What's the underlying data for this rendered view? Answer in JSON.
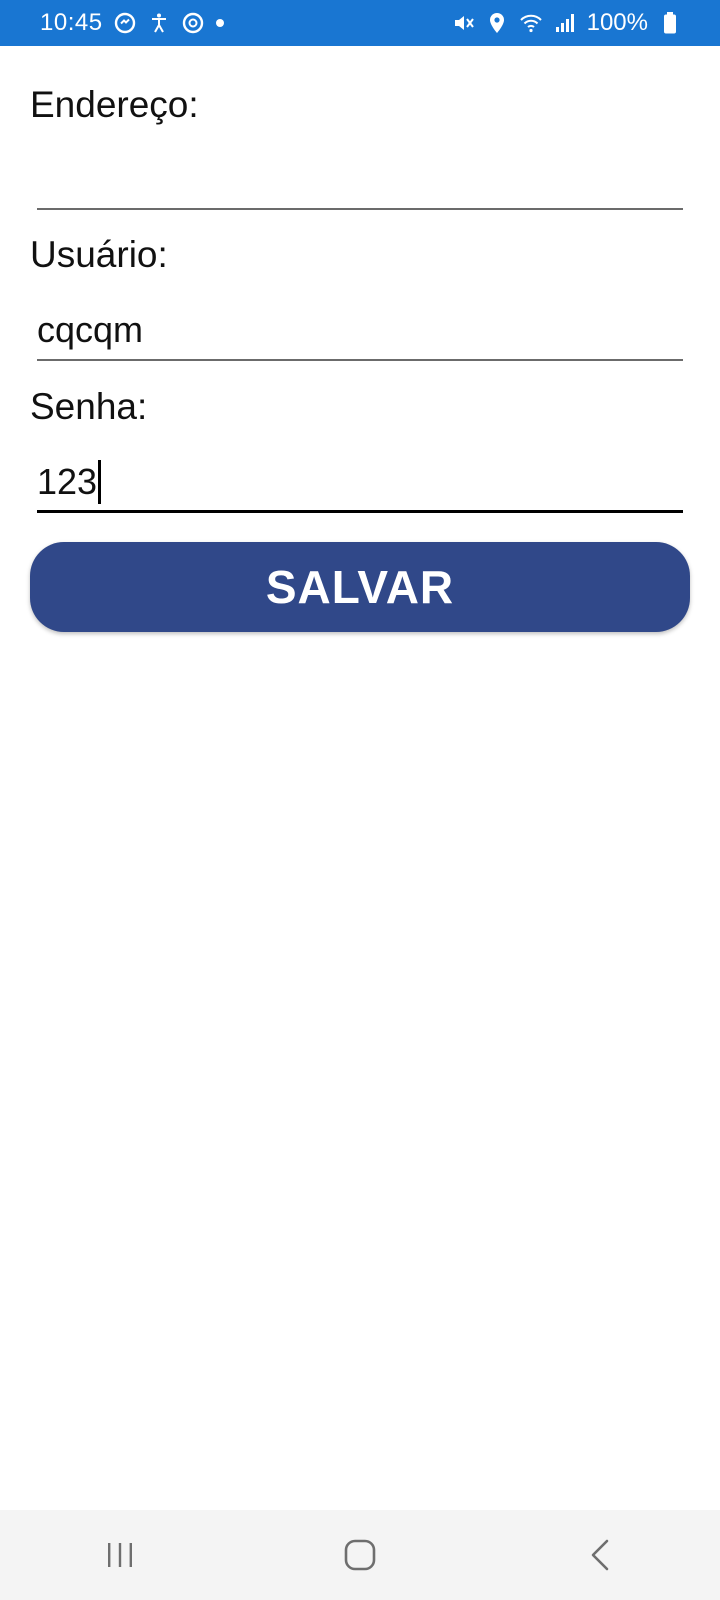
{
  "status_bar": {
    "time": "10:45",
    "battery": "100%",
    "left_icons": [
      "messenger-icon",
      "accessibility-icon",
      "sync-icon",
      "notification-dot-icon"
    ],
    "right_icons": [
      "mute-icon",
      "location-icon",
      "wifi-icon",
      "signal-icon",
      "battery-icon"
    ],
    "background": "#1976d2"
  },
  "form": {
    "endereco": {
      "label": "Endereço:",
      "value": ""
    },
    "usuario": {
      "label": "Usuário:",
      "value": "cqcqm"
    },
    "senha": {
      "label": "Senha:",
      "value": "123",
      "focused": true
    }
  },
  "save_button": {
    "label": "SALVAR",
    "color": "#304889"
  },
  "nav_bar": {
    "buttons": [
      "recent-apps-icon",
      "home-icon",
      "back-icon"
    ]
  }
}
